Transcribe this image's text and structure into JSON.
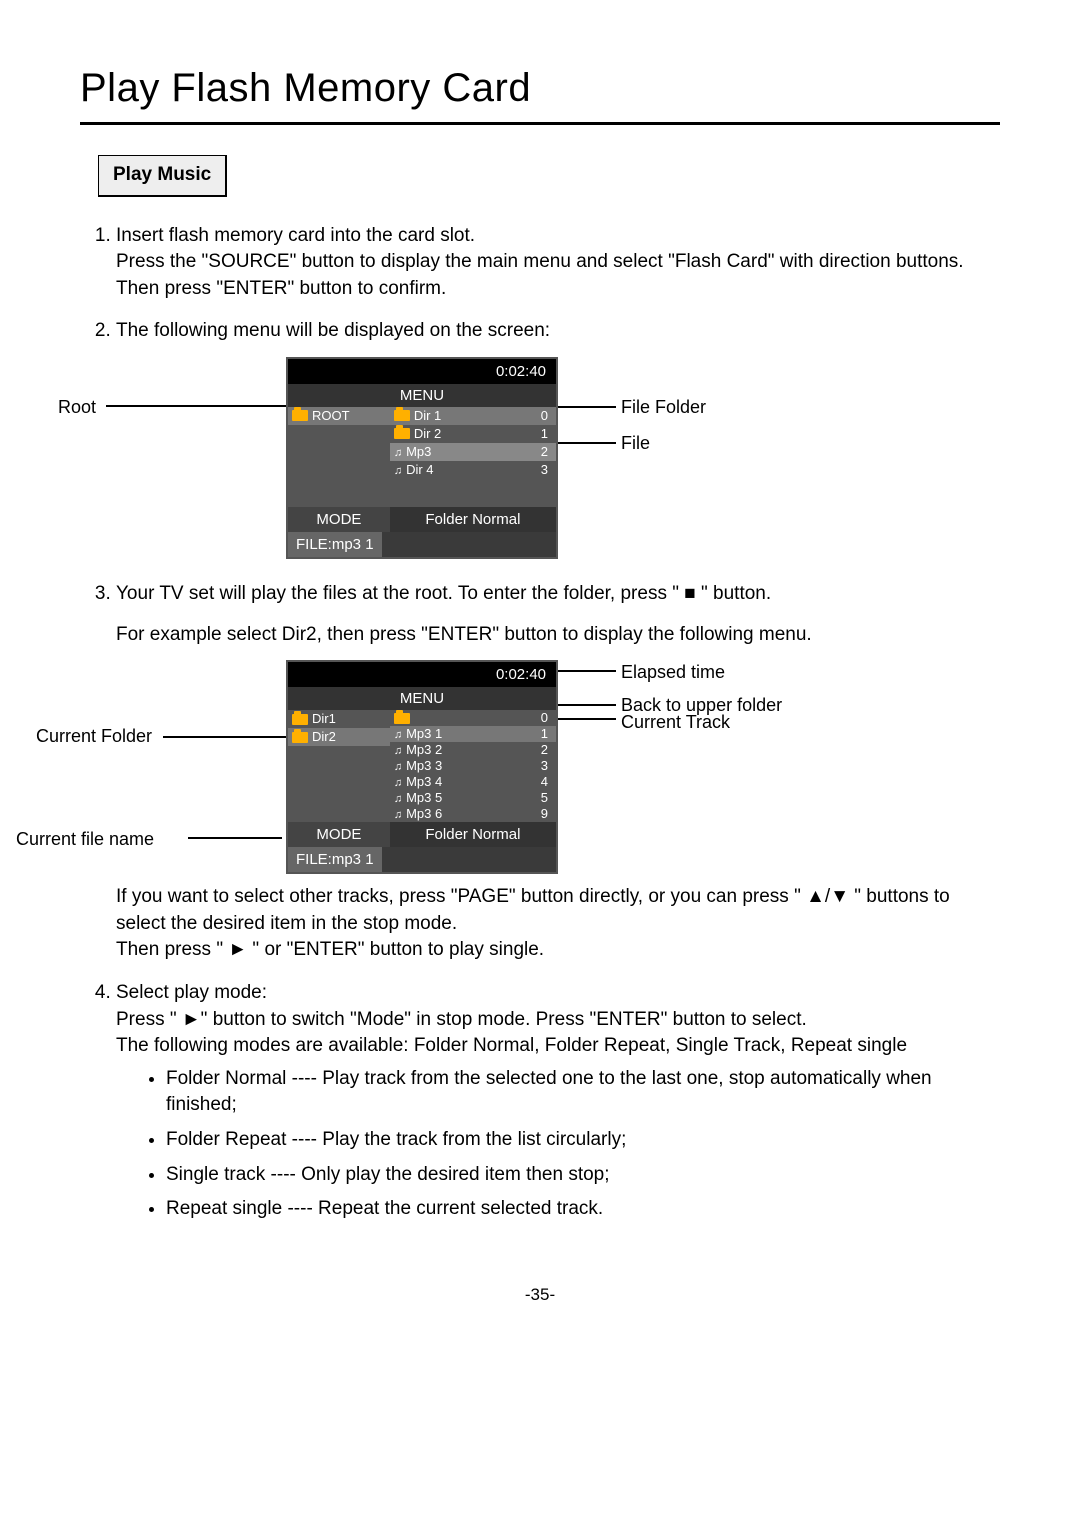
{
  "page": {
    "title": "Play Flash Memory Card",
    "subhead": "Play Music",
    "pagenum": "-35-"
  },
  "steps": {
    "s1a": "Insert flash memory card into the card slot.",
    "s1b": "Press the \"SOURCE\" button to display the main menu and select \"Flash Card\" with direction buttons. Then press \"ENTER\" button to confirm.",
    "s2": "The following menu will be displayed on the screen:",
    "s3a": "Your TV set will play the files at the root. To enter the folder, press \"  ■  \" button.",
    "s3b": "For example select Dir2, then press \"ENTER\" button to display the following menu.",
    "s3c": "If you want to select other tracks, press \"PAGE\" button directly, or you can press \" ▲/▼ \" buttons to select the desired item in the stop mode.",
    "s3d": "Then press \" ► \" or \"ENTER\" button to play single.",
    "s4a": "Select play mode:",
    "s4b": "Press \" ►\" button to switch \"Mode\" in stop mode. Press \"ENTER\" button to select.",
    "s4c": "The following modes are available: Folder Normal, Folder Repeat, Single Track, Repeat single"
  },
  "bullets": {
    "b1": "Folder Normal ---- Play track from the selected one to the last one, stop automatically when finished;",
    "b2": "Folder Repeat ---- Play the track from the list circularly;",
    "b3": "Single track ---- Only play the desired item then stop;",
    "b4": "Repeat single ---- Repeat the current selected track."
  },
  "screen1": {
    "time": "0:02:40",
    "menu": "MENU",
    "root": "ROOT",
    "items": [
      {
        "label": "Dir 1",
        "idx": "0"
      },
      {
        "label": "Dir 2",
        "idx": "1"
      },
      {
        "label": "Mp3",
        "idx": "2"
      },
      {
        "label": "Dir 4",
        "idx": "3"
      }
    ],
    "mode_label": "MODE",
    "mode_value": "Folder Normal",
    "file_label": "FILE:mp3 1"
  },
  "screen2": {
    "time": "0:02:40",
    "menu": "MENU",
    "left": [
      {
        "label": "Dir1"
      },
      {
        "label": "Dir2"
      }
    ],
    "upIdx": "0",
    "right": [
      {
        "label": "Mp3 1",
        "idx": "1"
      },
      {
        "label": "Mp3 2",
        "idx": "2"
      },
      {
        "label": "Mp3 3",
        "idx": "3"
      },
      {
        "label": "Mp3 4",
        "idx": "4"
      },
      {
        "label": "Mp3 5",
        "idx": "5"
      },
      {
        "label": "Mp3 6",
        "idx": "9"
      }
    ],
    "mode_label": "MODE",
    "mode_value": "Folder Normal",
    "file_label": "FILE:mp3 1"
  },
  "callouts": {
    "root": "Root",
    "file_folder": "File Folder",
    "file": "File",
    "elapsed": "Elapsed time",
    "back": "Back to upper folder",
    "cur_track": "Current Track",
    "cur_folder": "Current Folder",
    "cur_file": "Current file name"
  }
}
